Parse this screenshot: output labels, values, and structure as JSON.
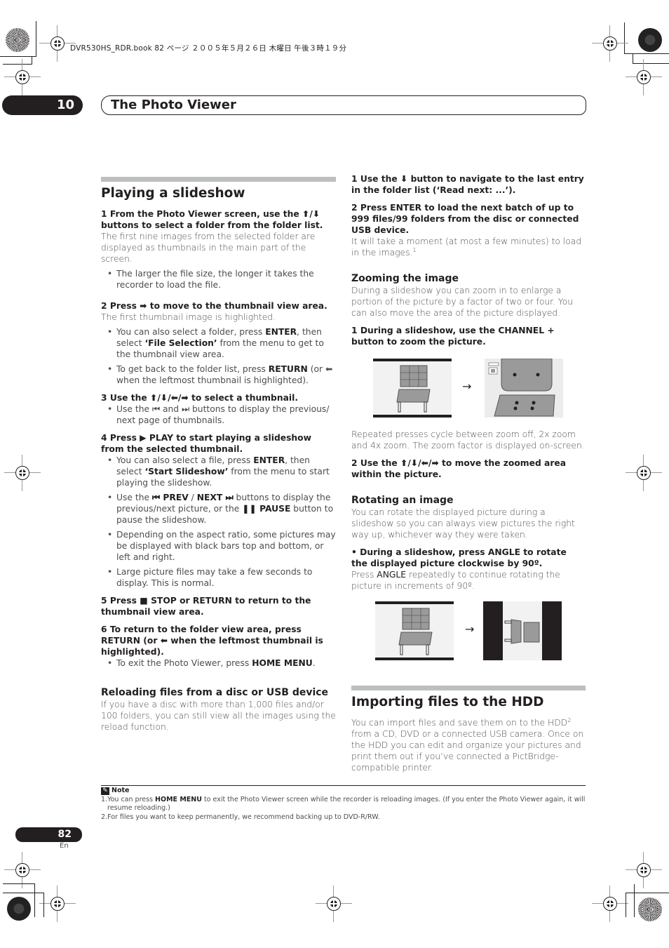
{
  "print_header": "DVR530HS_RDR.book  82 ページ  ２００５年５月２６日  木曜日  午後３時１９分",
  "chapter": {
    "number": "10",
    "title": "The Photo Viewer"
  },
  "left": {
    "heading": "Playing a slideshow",
    "s1_title": "1    From the Photo Viewer screen, use the ⬆/⬇ buttons to select a folder from the folder list.",
    "s1_body": "The first nine images from the selected folder are displayed as thumbnails in the main part of the screen.",
    "s1_b1": "The larger the file size, the longer it takes the recorder to load the file.",
    "s2_title": "2    Press ➡ to move to the thumbnail view area.",
    "s2_body": "The first thumbnail image is highlighted.",
    "s2_b1_a": "You can also select a folder, press ",
    "s2_b1_k1": "ENTER",
    "s2_b1_b": ", then select ",
    "s2_b1_k2": "‘File Selection’",
    "s2_b1_c": " from the menu to get to the thumbnail view area.",
    "s2_b2_a": "To get back to the folder list, press ",
    "s2_b2_k": "RETURN",
    "s2_b2_b": " (or ⬅ when the leftmost thumbnail is highlighted).",
    "s3_title": "3    Use the ⬆/⬇/⬅/➡ to select a thumbnail.",
    "s3_b1": "Use the ⏮ and ⏭ buttons to display the previous/ next page of thumbnails.",
    "s4_title": "4    Press ▶ PLAY to start playing a slideshow from the selected thumbnail.",
    "s4_b1_a": "You can also select a file, press ",
    "s4_b1_k1": "ENTER",
    "s4_b1_b": ", then select ",
    "s4_b1_k2": "‘Start Slideshow’",
    "s4_b1_c": " from the menu to start playing the slideshow.",
    "s4_b2_a": "Use the ",
    "s4_b2_k1": "⏮ PREV",
    "s4_b2_b": " / ",
    "s4_b2_k2": "NEXT ⏭",
    "s4_b2_c": " buttons to display the previous/next picture, or the ",
    "s4_b2_k3": "❚❚ PAUSE",
    "s4_b2_d": " button to pause the slideshow.",
    "s4_b3": "Depending on the aspect ratio, some pictures may be displayed with black bars top and bottom, or left and right.",
    "s4_b4": "Large picture files may take a few seconds to display. This is normal.",
    "s5_title": "5    Press ■ STOP or RETURN to return to the thumbnail view area.",
    "s6_title": "6    To return to the folder view area, press RETURN (or ⬅ when the leftmost thumbnail is highlighted).",
    "s6_b1_a": "To exit the Photo Viewer, press ",
    "s6_b1_k": "HOME MENU",
    "s6_b1_b": ".",
    "reload_heading": "Reloading files from a disc or USB device",
    "reload_body": "If you have a disc with more than 1,000 files and/or 100 folders, you can still view all the images using the reload function."
  },
  "right": {
    "r1_title": "1    Use the ⬇ button to navigate to the last entry in the folder list (‘Read next: ...’).",
    "r2_title": "2    Press ENTER to load the next batch of up to 999 files/99 folders from the disc or connected USB device.",
    "r2_body": "It will take a moment (at most a few minutes) to load in the images.",
    "r2_footref": "1",
    "zoom_heading": "Zooming the image",
    "zoom_body": "During a slideshow you can zoom in to enlarge a portion of the picture by a factor of two or four. You can also move the area of the picture displayed.",
    "z1_title": "1    During a slideshow, use the CHANNEL + button to zoom the picture.",
    "z1_after": "Repeated presses cycle between zoom off, 2x zoom and 4x zoom. The zoom factor is displayed on-screen.",
    "z2_title": "2    Use the ⬆/⬇/⬅/➡ to move the zoomed area within the picture.",
    "rotate_heading": "Rotating an image",
    "rotate_body": "You can rotate the displayed picture during a slideshow so you can always view pictures the right way up, whichever way they were taken.",
    "rot_step": "•    During a slideshow, press ANGLE to rotate the displayed picture clockwise by 90º.",
    "rot_body_a": "Press ",
    "rot_body_k": "ANGLE",
    "rot_body_b": " repeatedly to continue rotating the picture in increments of 90º.",
    "arrow": "→",
    "import_heading": "Importing files to the HDD",
    "import_body_a": "You can import files and save them on to the HDD",
    "import_footref": "2",
    "import_body_b": " from a CD, DVD or a connected USB camera. Once on the HDD you can edit and organize your pictures and print them out if you’ve connected a PictBridge-compatible printer."
  },
  "notes": {
    "label": "Note",
    "n1_a": "1.You can press ",
    "n1_k": "HOME MENU",
    "n1_b": " to exit the Photo Viewer screen while the recorder is reloading images. (If you enter the Photo Viewer again, it will resume reloading.)",
    "n2": "2.For files you want to keep permanently, we recommend backing up to DVD-R/RW."
  },
  "footer": {
    "page": "82",
    "lang": "En"
  }
}
